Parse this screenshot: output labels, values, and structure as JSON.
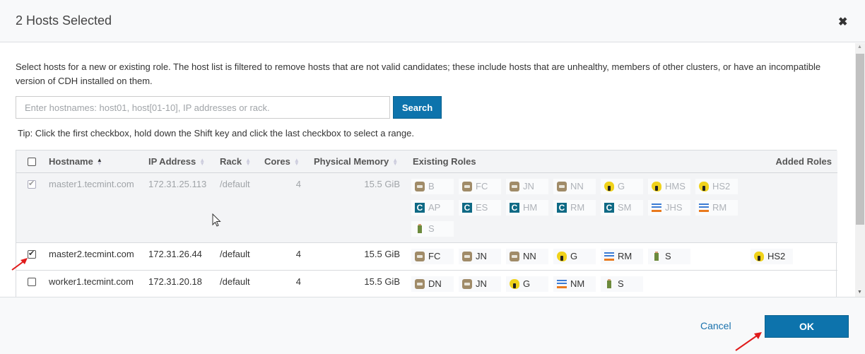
{
  "header": {
    "title": "2 Hosts Selected",
    "close_label": "✖"
  },
  "body": {
    "description": "Select hosts for a new or existing role. The host list is filtered to remove hosts that are not valid candidates; these include hosts that are unhealthy, members of other clusters, or have an incompatible version of CDH installed on them.",
    "search": {
      "placeholder": "Enter hostnames: host01, host[01-10], IP addresses or rack.",
      "value": "",
      "button_label": "Search"
    },
    "tip": "Tip: Click the first checkbox, hold down the Shift key and click the last checkbox to select a range."
  },
  "table": {
    "columns": {
      "hostname": "Hostname",
      "ip": "IP Address",
      "rack": "Rack",
      "cores": "Cores",
      "memory": "Physical Memory",
      "existing_roles": "Existing Roles",
      "added_roles": "Added Roles"
    },
    "sort": {
      "column": "hostname",
      "direction": "asc"
    },
    "rows": [
      {
        "hostname": "master1.tecmint.com",
        "ip": "172.31.25.113",
        "rack": "/default",
        "cores": "4",
        "memory": "15.5 GiB",
        "checked": true,
        "disabled": true,
        "existing_roles": [
          {
            "icon": "hdfs-icon",
            "label": "B"
          },
          {
            "icon": "hdfs-icon",
            "label": "FC"
          },
          {
            "icon": "hdfs-icon",
            "label": "JN"
          },
          {
            "icon": "hdfs-icon",
            "label": "NN"
          },
          {
            "icon": "hive-icon",
            "label": "G"
          },
          {
            "icon": "hive-icon",
            "label": "HMS"
          },
          {
            "icon": "hive-icon",
            "label": "HS2"
          },
          {
            "icon": "cloudera-icon",
            "label": "AP"
          },
          {
            "icon": "cloudera-icon",
            "label": "ES"
          },
          {
            "icon": "cloudera-icon",
            "label": "HM"
          },
          {
            "icon": "cloudera-icon",
            "label": "RM"
          },
          {
            "icon": "cloudera-icon",
            "label": "SM"
          },
          {
            "icon": "yarn-icon",
            "label": "JHS"
          },
          {
            "icon": "yarn-icon",
            "label": "RM"
          },
          {
            "icon": "sqoop-icon",
            "label": "S"
          }
        ],
        "added_roles": []
      },
      {
        "hostname": "master2.tecmint.com",
        "ip": "172.31.26.44",
        "rack": "/default",
        "cores": "4",
        "memory": "15.5 GiB",
        "checked": true,
        "disabled": false,
        "existing_roles": [
          {
            "icon": "hdfs-icon",
            "label": "FC"
          },
          {
            "icon": "hdfs-icon",
            "label": "JN"
          },
          {
            "icon": "hdfs-icon",
            "label": "NN"
          },
          {
            "icon": "hive-icon",
            "label": "G"
          },
          {
            "icon": "yarn-icon",
            "label": "RM"
          },
          {
            "icon": "sqoop-icon",
            "label": "S"
          }
        ],
        "added_roles": [
          {
            "icon": "hive-icon",
            "label": "HS2"
          }
        ]
      },
      {
        "hostname": "worker1.tecmint.com",
        "ip": "172.31.20.18",
        "rack": "/default",
        "cores": "4",
        "memory": "15.5 GiB",
        "checked": false,
        "disabled": false,
        "existing_roles": [
          {
            "icon": "hdfs-icon",
            "label": "DN"
          },
          {
            "icon": "hdfs-icon",
            "label": "JN"
          },
          {
            "icon": "hive-icon",
            "label": "G"
          },
          {
            "icon": "yarn-icon",
            "label": "NM"
          },
          {
            "icon": "sqoop-icon",
            "label": "S"
          }
        ],
        "added_roles": []
      }
    ]
  },
  "footer": {
    "cancel_label": "Cancel",
    "ok_label": "OK"
  },
  "colors": {
    "primary": "#0d73ac",
    "link": "#1a72ad",
    "annotation_arrow": "#e01b1b"
  }
}
